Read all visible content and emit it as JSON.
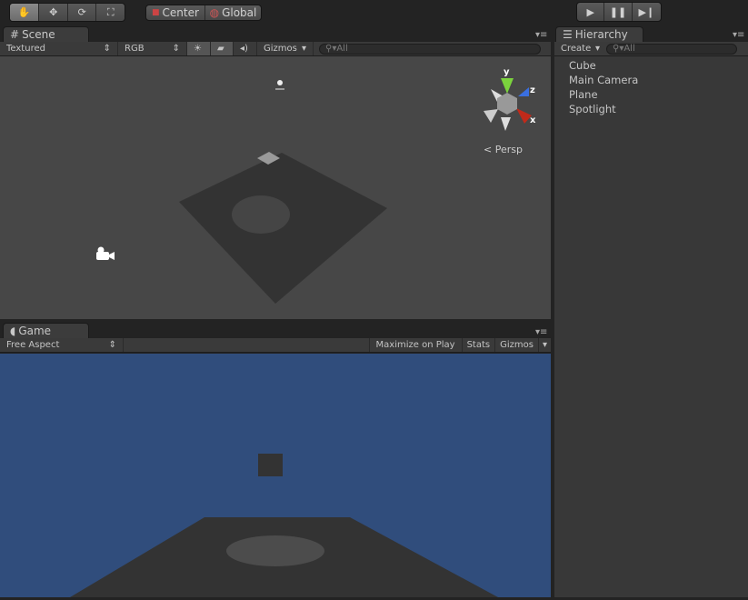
{
  "toolbar": {
    "tools": [
      {
        "icon": "hand-icon",
        "active": true
      },
      {
        "icon": "move-icon"
      },
      {
        "icon": "rotate-icon"
      },
      {
        "icon": "scale-icon"
      }
    ],
    "pivot_label": "Center",
    "space_label": "Global",
    "play": [
      "play-icon",
      "pause-icon",
      "step-icon"
    ]
  },
  "scene": {
    "tab": "Scene",
    "draw_mode": "Textured",
    "render_mode": "RGB",
    "gizmos": "Gizmos",
    "search_placeholder": "All",
    "projection": "Persp",
    "axes": {
      "y": "y",
      "z": "z",
      "x": "x"
    },
    "background": "#474747"
  },
  "game": {
    "tab": "Game",
    "aspect": "Free Aspect",
    "maximize": "Maximize on Play",
    "stats": "Stats",
    "gizmos": "Gizmos",
    "background": "#304d7c"
  },
  "hierarchy": {
    "tab": "Hierarchy",
    "create": "Create",
    "search_placeholder": "All",
    "items": [
      "Cube",
      "Main Camera",
      "Plane",
      "Spotlight"
    ]
  }
}
